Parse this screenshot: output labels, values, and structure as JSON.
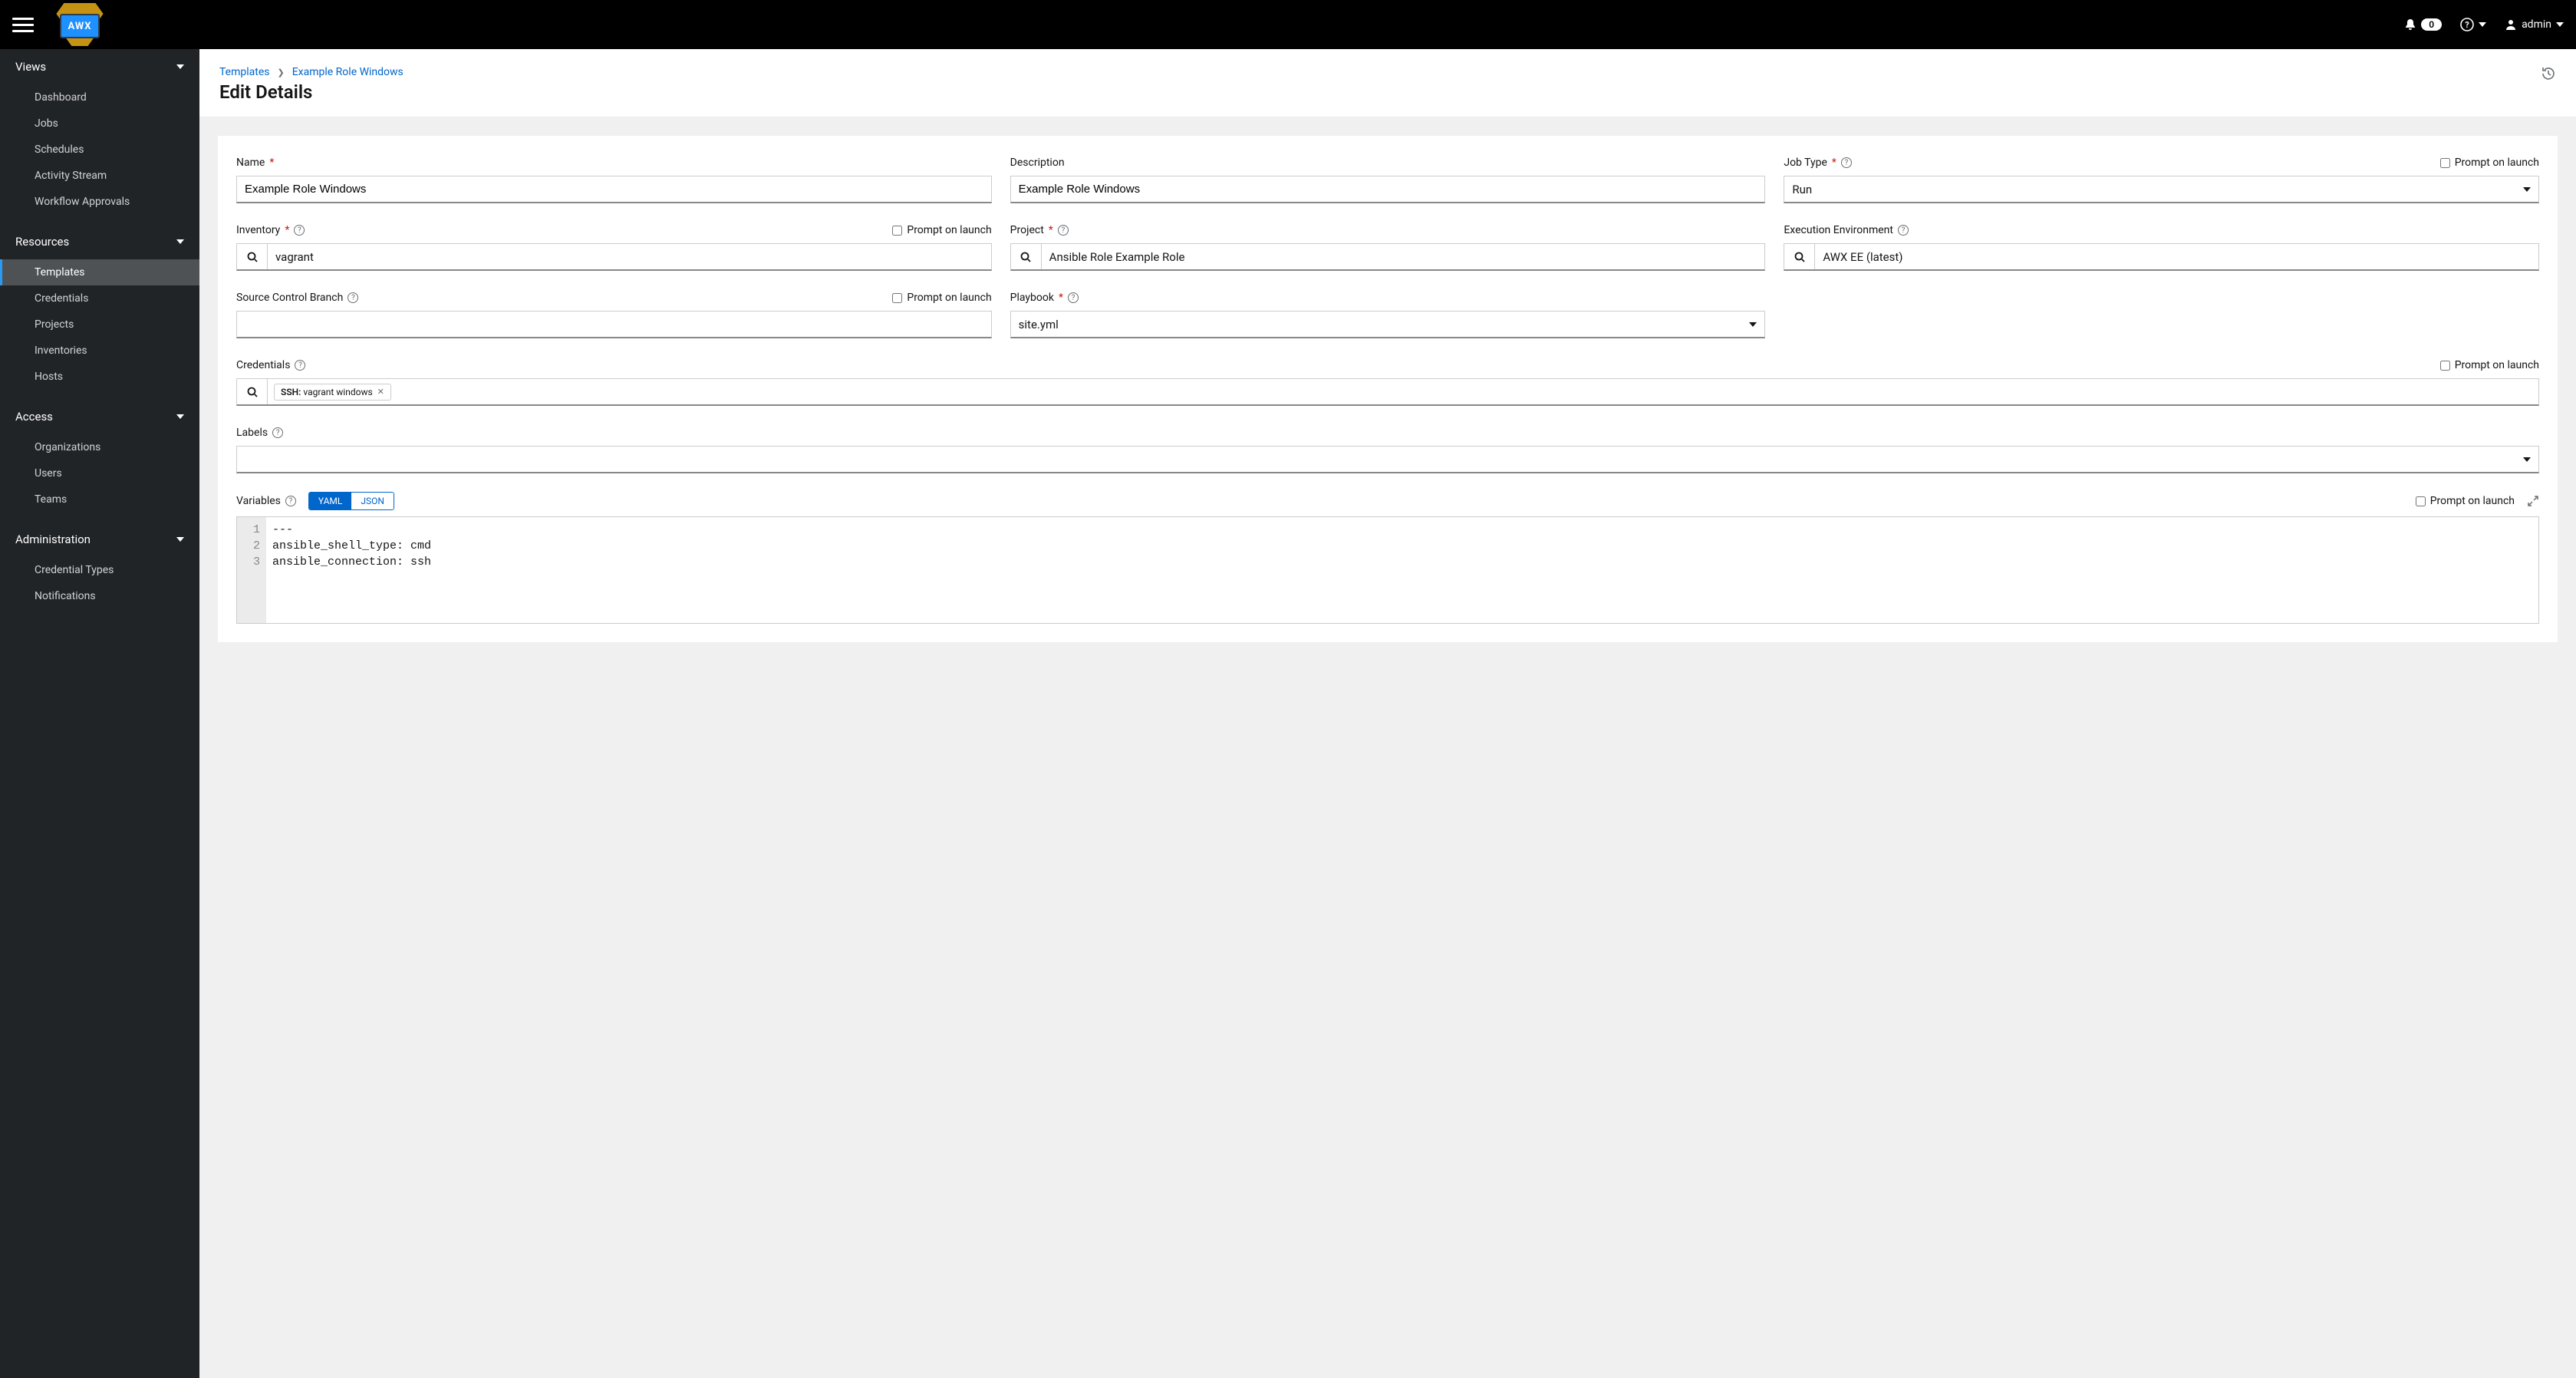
{
  "topbar": {
    "notification_count": "0",
    "user_label": "admin"
  },
  "sidebar": {
    "sections": [
      {
        "label": "Views",
        "items": [
          "Dashboard",
          "Jobs",
          "Schedules",
          "Activity Stream",
          "Workflow Approvals"
        ]
      },
      {
        "label": "Resources",
        "items": [
          "Templates",
          "Credentials",
          "Projects",
          "Inventories",
          "Hosts"
        ],
        "active": "Templates"
      },
      {
        "label": "Access",
        "items": [
          "Organizations",
          "Users",
          "Teams"
        ]
      },
      {
        "label": "Administration",
        "items": [
          "Credential Types",
          "Notifications"
        ]
      }
    ]
  },
  "breadcrumb": {
    "root": "Templates",
    "current": "Example Role Windows"
  },
  "page_title": "Edit Details",
  "labels": {
    "name": "Name",
    "description": "Description",
    "job_type": "Job Type",
    "inventory": "Inventory",
    "project": "Project",
    "exec_env": "Execution Environment",
    "scb": "Source Control Branch",
    "playbook": "Playbook",
    "credentials": "Credentials",
    "labels_field": "Labels",
    "variables": "Variables",
    "prompt": "Prompt on launch",
    "yaml": "YAML",
    "json": "JSON"
  },
  "values": {
    "name": "Example Role Windows",
    "description": "Example Role Windows",
    "job_type": "Run",
    "inventory": "vagrant",
    "project": "Ansible Role Example Role",
    "exec_env": "AWX EE (latest)",
    "scb": "",
    "playbook": "site.yml",
    "cred_chip_prefix": "SSH:",
    "cred_chip_value": "vagrant windows",
    "code_lines": [
      "---",
      "ansible_shell_type: cmd",
      "ansible_connection: ssh"
    ]
  }
}
